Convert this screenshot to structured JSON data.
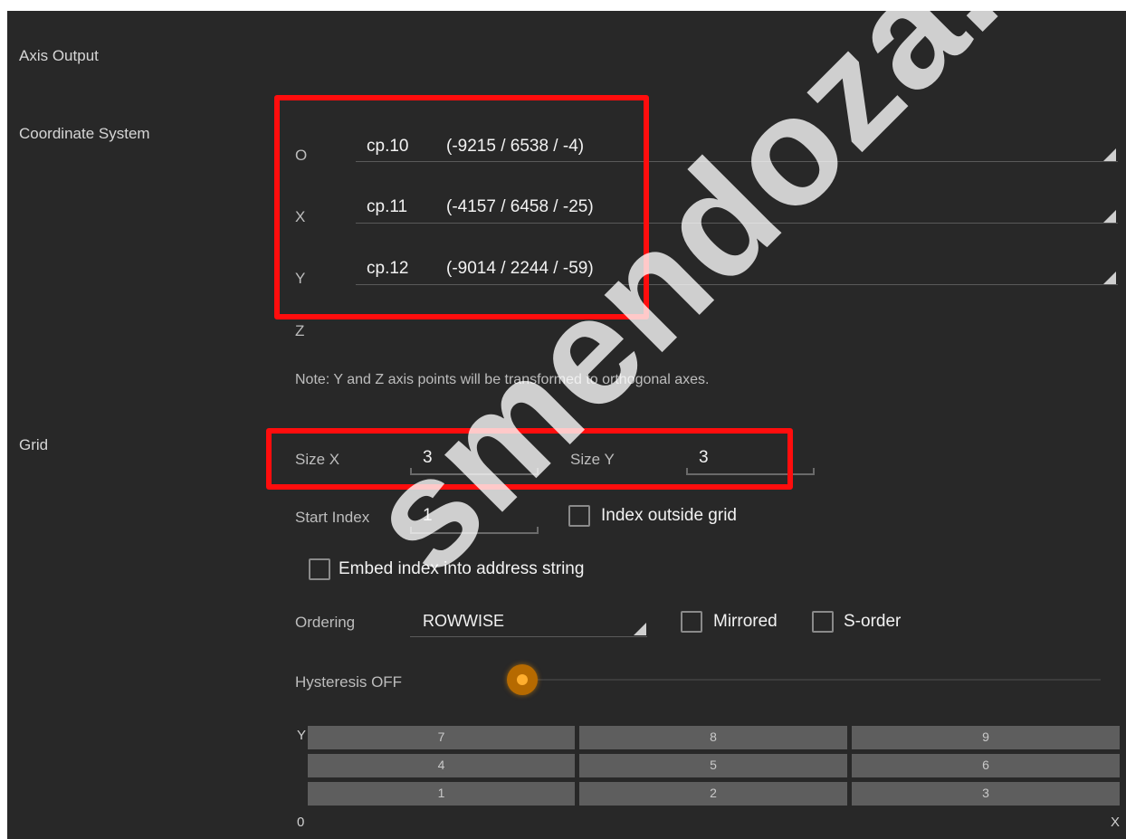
{
  "labels": {
    "axis_output": "Axis Output",
    "coordinate_system": "Coordinate System",
    "grid": "Grid"
  },
  "coordinate_system": {
    "rows": [
      {
        "axis": "O",
        "point": "cp.10",
        "coords": "(-9215 / 6538 / -4)"
      },
      {
        "axis": "X",
        "point": "cp.11",
        "coords": "(-4157 / 6458 / -25)"
      },
      {
        "axis": "Y",
        "point": "cp.12",
        "coords": "(-9014 / 2244 / -59)"
      }
    ],
    "z_label": "Z",
    "note": "Note: Y and Z axis points will be transformed to orthogonal axes."
  },
  "grid": {
    "size_x_label": "Size X",
    "size_x_value": "3",
    "size_y_label": "Size Y",
    "size_y_value": "3",
    "start_index_label": "Start Index",
    "start_index_value": "1",
    "index_outside_grid_label": "Index outside grid",
    "index_outside_grid_checked": false,
    "embed_index_label": "Embed index into address string",
    "embed_index_checked": false,
    "ordering_label": "Ordering",
    "ordering_value": "ROWWISE",
    "mirrored_label": "Mirrored",
    "mirrored_checked": false,
    "s_order_label": "S-order",
    "s_order_checked": false,
    "hysteresis_label": "Hysteresis OFF",
    "preview": {
      "y_label": "Y",
      "x_label": "X",
      "origin_label": "0",
      "rows": [
        [
          "7",
          "8",
          "9"
        ],
        [
          "4",
          "5",
          "6"
        ],
        [
          "1",
          "2",
          "3"
        ]
      ]
    }
  },
  "colors": {
    "background": "#282828",
    "highlight": "#ff0d0d",
    "slider_accent": "#ffae2e"
  },
  "watermark": "smendoza.com"
}
